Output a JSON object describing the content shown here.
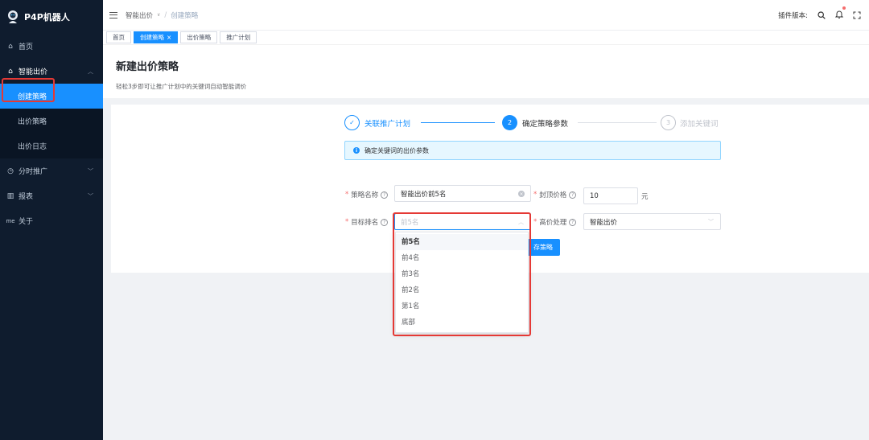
{
  "app": {
    "title": "P4P机器人"
  },
  "sidebar": {
    "items": [
      {
        "label": "首页",
        "icon": "home-icon"
      },
      {
        "label": "智能出价",
        "icon": "shopping-icon",
        "open": true,
        "children": [
          {
            "label": "创建策略",
            "active": true
          },
          {
            "label": "出价策略"
          },
          {
            "label": "出价日志"
          }
        ]
      },
      {
        "label": "分时推广",
        "icon": "clock-icon"
      },
      {
        "label": "报表",
        "icon": "chart-icon"
      },
      {
        "label": "关于",
        "icon": "about-icon",
        "icon_text": "me"
      }
    ]
  },
  "header": {
    "breadcrumb": [
      "智能出价",
      "创建策略"
    ],
    "plugin_version_label": "插件版本:"
  },
  "tags": [
    {
      "label": "首页",
      "active": false
    },
    {
      "label": "创建策略",
      "active": true,
      "closable": true
    },
    {
      "label": "出价策略",
      "active": false
    },
    {
      "label": "推广计划",
      "active": false
    }
  ],
  "page": {
    "title": "新建出价策略",
    "description": "轻松3步即可让推广计划中的关键词自动智能调价"
  },
  "steps": [
    {
      "index": "✓",
      "label": "关联推广计划",
      "status": "finished"
    },
    {
      "index": "2",
      "label": "确定策略参数",
      "status": "active"
    },
    {
      "index": "3",
      "label": "添加关键词",
      "status": "waiting"
    }
  ],
  "alert": {
    "text": "确定关键词的出价参数"
  },
  "form": {
    "strategy_name": {
      "label": "策略名称",
      "value": "智能出价前5名"
    },
    "top_price": {
      "label": "封顶价格",
      "value": "10",
      "unit": "元"
    },
    "target_rank": {
      "label": "目标排名",
      "placeholder": "前5名"
    },
    "high_price": {
      "label": "高价处理",
      "value": "智能出价"
    }
  },
  "dropdown": {
    "options": [
      "前5名",
      "前4名",
      "前3名",
      "前2名",
      "第1名",
      "底部"
    ],
    "selected": "前5名"
  },
  "buttons": {
    "save_tail": "存策略"
  },
  "colors": {
    "primary": "#1890ff",
    "sidebar_bg": "#0f1c2e",
    "highlight": "#e53935"
  }
}
